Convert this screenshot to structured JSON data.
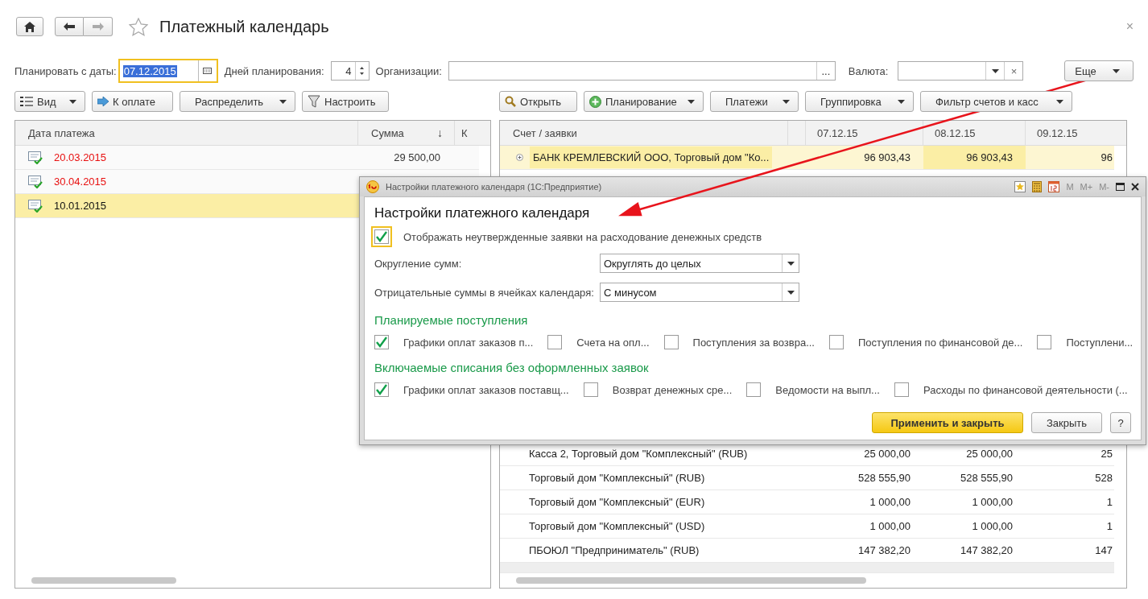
{
  "window": {
    "title": "Платежный календарь",
    "close": "×"
  },
  "filters": {
    "date_label": "Планировать с даты:",
    "date_value": "07.12.2015",
    "days_label": "Дней планирования:",
    "days_value": "4",
    "org_label": "Организации:",
    "org_button": "...",
    "currency_label": "Валюта:",
    "currency_clear": "×",
    "more_button": "Еще"
  },
  "left_toolbar": [
    {
      "label": "Вид",
      "kind": "view",
      "dropdown": true
    },
    {
      "label": "К оплате",
      "kind": "arrow",
      "dropdown": false
    },
    {
      "label": "Распределить",
      "kind": "plain",
      "dropdown": true
    },
    {
      "label": "Настроить",
      "kind": "filter",
      "dropdown": false
    }
  ],
  "right_toolbar": [
    {
      "label": "Открыть",
      "kind": "search",
      "dropdown": false
    },
    {
      "label": "Планирование",
      "kind": "plus",
      "dropdown": true
    },
    {
      "label": "Платежи",
      "kind": "plain",
      "dropdown": true
    },
    {
      "label": "Группировка",
      "kind": "plain",
      "dropdown": true
    },
    {
      "label": "Фильтр счетов и касс",
      "kind": "plain",
      "dropdown": true
    }
  ],
  "payments": {
    "columns": [
      "Дата платежа",
      "Сумма",
      "К"
    ],
    "sort_mark": "↓",
    "rows": [
      {
        "date": "20.03.2015",
        "amount": "29 500,00",
        "overdue": true,
        "selected": false
      },
      {
        "date": "30.04.2015",
        "amount": "",
        "overdue": true,
        "selected": false
      },
      {
        "date": "10.01.2015",
        "amount": "",
        "overdue": false,
        "selected": true
      }
    ]
  },
  "calendar": {
    "columns": [
      "Счет / заявки",
      "07.12.15",
      "08.12.15",
      "09.12.15"
    ],
    "rows": [
      {
        "name": "БАНК КРЕМЛЕВСКИЙ ООО, Торговый дом \"Ко...",
        "expandable": true,
        "selected": true,
        "values": [
          "96 903,43",
          "96 903,43",
          "96"
        ]
      },
      {
        "name": "Касса 2, Торговый дом \"Комплексный\" (RUB)",
        "expandable": false,
        "selected": false,
        "values": [
          "25 000,00",
          "25 000,00",
          "25"
        ]
      },
      {
        "name": "Торговый дом \"Комплексный\" (RUB)",
        "expandable": false,
        "selected": false,
        "values": [
          "528 555,90",
          "528 555,90",
          "528"
        ]
      },
      {
        "name": "Торговый дом \"Комплексный\" (EUR)",
        "expandable": false,
        "selected": false,
        "values": [
          "1 000,00",
          "1 000,00",
          "1"
        ]
      },
      {
        "name": "Торговый дом \"Комплексный\" (USD)",
        "expandable": false,
        "selected": false,
        "values": [
          "1 000,00",
          "1 000,00",
          "1"
        ]
      },
      {
        "name": "ПБОЮЛ \"Предприниматель\" (RUB)",
        "expandable": false,
        "selected": false,
        "values": [
          "147 382,20",
          "147 382,20",
          "147"
        ]
      }
    ]
  },
  "dialog": {
    "title": "Настройки платежного календаря  (1С:Предприятие)",
    "memory_buttons": [
      "M",
      "M+",
      "M-"
    ],
    "heading": "Настройки платежного календаря",
    "show_unapproved": {
      "label": "Отображать неутвержденные заявки на расходование денежных средств",
      "checked": true
    },
    "fields": [
      {
        "label": "Округление сумм:",
        "value": "Округлять до целых"
      },
      {
        "label": "Отрицательные суммы в ячейках календаря:",
        "value": "С минусом"
      }
    ],
    "sections": [
      {
        "title": "Планируемые поступления",
        "items": [
          {
            "label": "Графики оплат заказов п...",
            "checked": true
          },
          {
            "label": "Счета на опл...",
            "checked": false
          },
          {
            "label": "Поступления за возвра...",
            "checked": false
          },
          {
            "label": "Поступления по финансовой де...",
            "checked": false
          },
          {
            "label": "Поступлени...",
            "checked": false
          }
        ]
      },
      {
        "title": "Включаемые списания без оформленных заявок",
        "items": [
          {
            "label": "Графики оплат заказов поставщ...",
            "checked": true
          },
          {
            "label": "Возврат денежных сре...",
            "checked": false
          },
          {
            "label": "Ведомости на выпл...",
            "checked": false
          },
          {
            "label": "Расходы по финансовой деятельности (...",
            "checked": false
          }
        ]
      }
    ],
    "buttons": {
      "apply": "Применить и закрыть",
      "close": "Закрыть",
      "help": "?"
    }
  }
}
